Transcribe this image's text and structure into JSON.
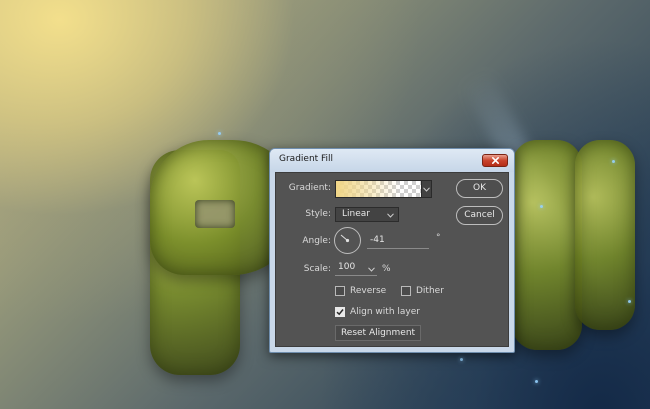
{
  "dialog": {
    "title": "Gradient Fill",
    "gradient_label": "Gradient:",
    "style_label": "Style:",
    "style_value": "Linear",
    "angle_label": "Angle:",
    "angle_value": "-41",
    "degree_symbol": "°",
    "scale_label": "Scale:",
    "scale_value": "100",
    "percent_symbol": "%",
    "reverse_label": "Reverse",
    "reverse_checked": false,
    "dither_label": "Dither",
    "dither_checked": false,
    "align_label": "Align with layer",
    "align_checked": true,
    "reset_label": "Reset Alignment",
    "ok_label": "OK",
    "cancel_label": "Cancel"
  },
  "icons": {
    "close": "close-icon",
    "dropdown": "chevron-down-icon",
    "check": "checkmark-icon",
    "angle": "angle-dial-icon"
  },
  "colors": {
    "gradient_start": "#f1d687",
    "dialog_body": "#535353",
    "titlebar": "#c9d8e9",
    "close_button": "#c9432b"
  }
}
